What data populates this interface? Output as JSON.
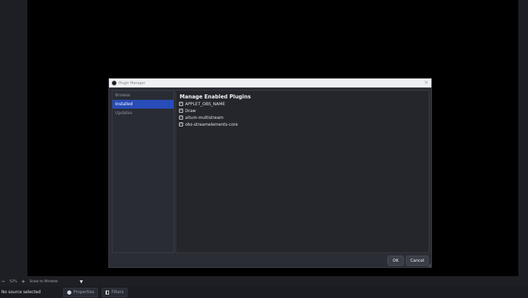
{
  "dialog": {
    "title": "Plugin Manager",
    "close_glyph": "×",
    "sidebar": [
      {
        "label": "Browse"
      },
      {
        "label": "Installed"
      },
      {
        "label": "Updates"
      }
    ],
    "heading": "Manage Enabled Plugins",
    "plugins": [
      {
        "name": "APPLET_OBS_NAME",
        "checked": true
      },
      {
        "name": "Draw",
        "checked": true
      },
      {
        "name": "aitum-multistream",
        "checked": true
      },
      {
        "name": "obs-streamelements-core",
        "checked": true
      }
    ],
    "ok_label": "OK",
    "cancel_label": "Cancel"
  },
  "zoombar": {
    "minus": "−",
    "zoom": "52%",
    "plus": "+",
    "scale_mode": "Scale to Window",
    "caret": "▼"
  },
  "status": {
    "no_source": "No source selected",
    "properties_label": "Properties",
    "filters_label": "Filters"
  },
  "colors": {
    "accent": "#284cb8",
    "background": "#1e1f24",
    "dialog": "#2b2d35"
  }
}
